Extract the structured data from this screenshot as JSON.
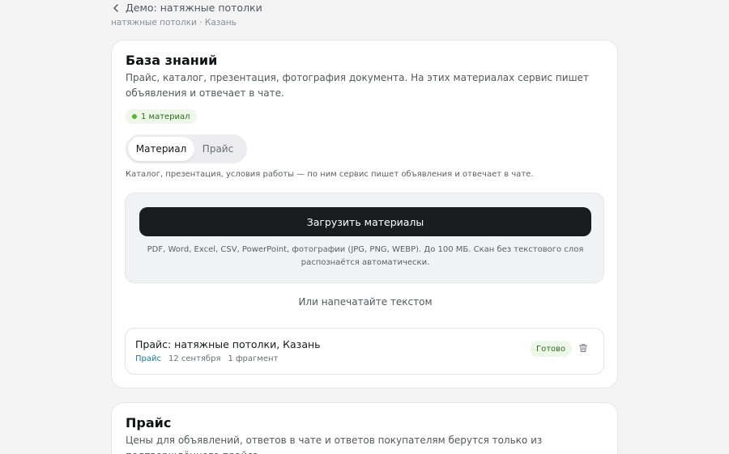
{
  "nav": {
    "back_label": "Демо: натяжные потолки",
    "subtitle": "натяжные потолки · Казань"
  },
  "knowledge_base": {
    "title": "База знаний",
    "description": "Прайс, каталог, презентация, фотография документа. На этих материалах сервис пишет объявления и отвечает в чате.",
    "count_badge": "1 материал",
    "tabs": [
      {
        "label": "Материал",
        "active": true
      },
      {
        "label": "Прайс",
        "active": false
      }
    ],
    "hint": "Каталог, презентация, условия работы — по ним сервис пишет объявления и отвечает в чате.",
    "upload_button": "Загрузить материалы",
    "upload_note_line1": "PDF, Word, Excel, CSV, PowerPoint, фотографии (JPG, PNG, WEBP). До 100 МБ. Скан без текстового слоя",
    "upload_note_line2": "распознаётся автоматически.",
    "type_text_link": "Или напечатайте текстом",
    "materials": [
      {
        "title": "Прайс: натяжные потолки, Казань",
        "type": "Прайс",
        "date": "12 сентября",
        "fragments": "1 фрагмент",
        "status": "Готово",
        "delete_icon": "trash-icon"
      }
    ]
  },
  "price": {
    "title": "Прайс",
    "description": "Цены для объявлений, ответов в чате и ответов покупателям берутся только из подтверждённого прайса."
  },
  "colors": {
    "background": "#f3f3f4",
    "card": "#ffffff",
    "primary_button": "#1b1c20",
    "success_badge_bg": "#eef8e9",
    "success_text": "#2f6a1c",
    "type_accent": "#1f7a98"
  }
}
